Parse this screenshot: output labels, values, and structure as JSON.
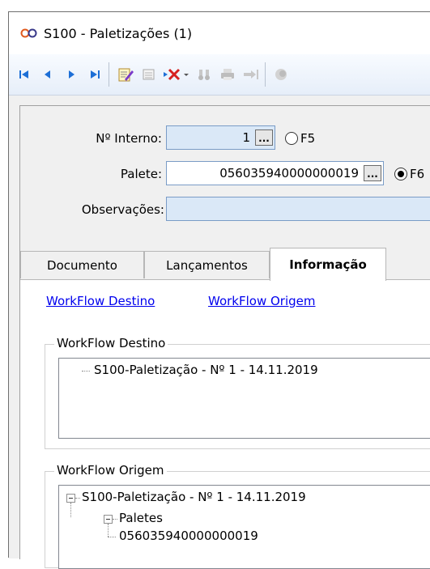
{
  "window": {
    "title": "S100 - Paletizações (1)",
    "icon": "link-infinity-icon"
  },
  "toolbar": {
    "buttons": [
      "first-record-icon",
      "previous-record-icon",
      "next-record-icon",
      "last-record-icon",
      "edit-icon",
      "grid-icon",
      "delete-icon",
      "find-icon",
      "print-icon",
      "export-icon",
      "more-icon"
    ]
  },
  "form": {
    "internal_no": {
      "label": "Nº Interno:",
      "value": "1",
      "radio_label": "F5"
    },
    "pallet": {
      "label": "Palete:",
      "value": "056035940000000019",
      "radio_label": "F6"
    },
    "observations": {
      "label": "Observações:",
      "value": ""
    },
    "ellipsis": "..."
  },
  "tabs": [
    {
      "label": "Documento",
      "active": false
    },
    {
      "label": "Lançamentos",
      "active": false
    },
    {
      "label": "Informação",
      "active": true
    }
  ],
  "links": {
    "dest": "WorkFlow Destino",
    "origin": "WorkFlow Origem"
  },
  "dest_group": {
    "title": "WorkFlow Destino",
    "items": [
      {
        "text": "S100-Paletização - Nº 1  -  14.11.2019"
      }
    ]
  },
  "origin_group": {
    "title": "WorkFlow Origem",
    "items": [
      {
        "text": "S100-Paletização - Nº 1  -  14.11.2019"
      },
      {
        "text": "Paletes"
      },
      {
        "text": "056035940000000019"
      }
    ]
  },
  "colors": {
    "link": "#0000ee",
    "readonly_field": "#dae8f7",
    "field_border": "#7a9cc6",
    "panel": "#f0f0f0"
  }
}
